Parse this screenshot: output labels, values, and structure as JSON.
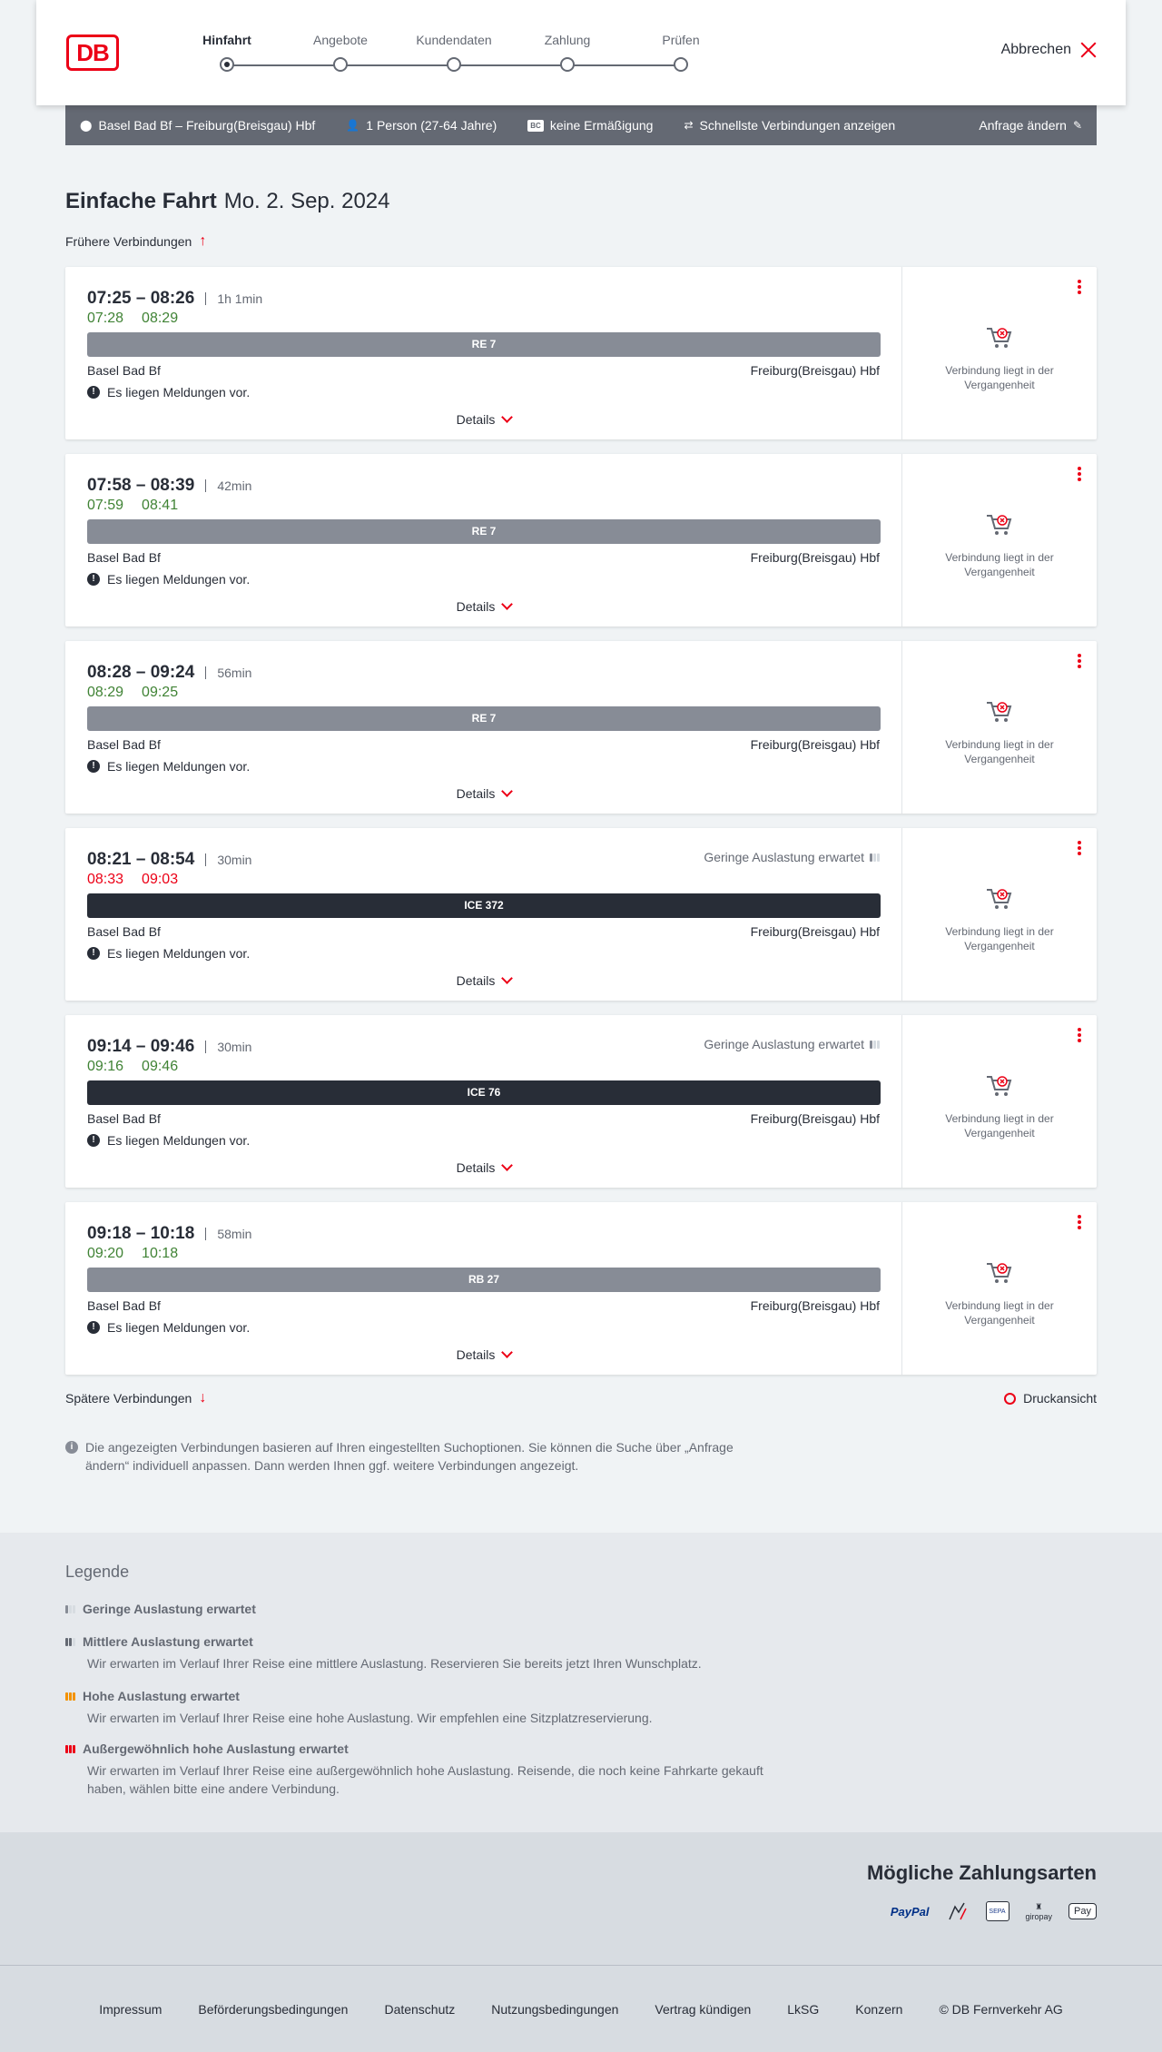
{
  "header": {
    "logo": "DB",
    "steps": [
      {
        "label": "Hinfahrt",
        "active": true
      },
      {
        "label": "Angebote",
        "active": false
      },
      {
        "label": "Kundendaten",
        "active": false
      },
      {
        "label": "Zahlung",
        "active": false
      },
      {
        "label": "Prüfen",
        "active": false
      }
    ],
    "cancel_label": "Abbrechen"
  },
  "summary": {
    "route": "Basel Bad Bf – Freiburg(Breisgau) Hbf",
    "passengers": "1 Person (27-64 Jahre)",
    "discount_badge": "BC",
    "discount": "keine Ermäßigung",
    "fastest": "Schnellste Verbindungen anzeigen",
    "change": "Anfrage ändern"
  },
  "title": {
    "main": "Einfache Fahrt",
    "date": "Mo. 2. Sep. 2024"
  },
  "earlier_label": "Frühere Verbindungen",
  "later_label": "Spätere Verbindungen",
  "print_label": "Druckansicht",
  "connections": [
    {
      "times": "07:25 – 08:26",
      "duration": "1h 1min",
      "rt_dep": "07:28",
      "rt_arr": "08:29",
      "rt_status": "ok",
      "train": "RE 7",
      "train_type": "reg",
      "from": "Basel Bad Bf",
      "to": "Freiburg(Breisgau) Hbf",
      "message": "Es liegen Meldungen vor.",
      "details": "Details",
      "load": "",
      "past": "Verbindung liegt in der Vergangenheit"
    },
    {
      "times": "07:58 – 08:39",
      "duration": "42min",
      "rt_dep": "07:59",
      "rt_arr": "08:41",
      "rt_status": "ok",
      "train": "RE 7",
      "train_type": "reg",
      "from": "Basel Bad Bf",
      "to": "Freiburg(Breisgau) Hbf",
      "message": "Es liegen Meldungen vor.",
      "details": "Details",
      "load": "",
      "past": "Verbindung liegt in der Vergangenheit"
    },
    {
      "times": "08:28 – 09:24",
      "duration": "56min",
      "rt_dep": "08:29",
      "rt_arr": "09:25",
      "rt_status": "ok",
      "train": "RE 7",
      "train_type": "reg",
      "from": "Basel Bad Bf",
      "to": "Freiburg(Breisgau) Hbf",
      "message": "Es liegen Meldungen vor.",
      "details": "Details",
      "load": "",
      "past": "Verbindung liegt in der Vergangenheit"
    },
    {
      "times": "08:21 – 08:54",
      "duration": "30min",
      "rt_dep": "08:33",
      "rt_arr": "09:03",
      "rt_status": "late",
      "train": "ICE 372",
      "train_type": "ice",
      "from": "Basel Bad Bf",
      "to": "Freiburg(Breisgau) Hbf",
      "message": "Es liegen Meldungen vor.",
      "details": "Details",
      "load": "Geringe Auslastung erwartet",
      "past": "Verbindung liegt in der Vergangenheit"
    },
    {
      "times": "09:14 – 09:46",
      "duration": "30min",
      "rt_dep": "09:16",
      "rt_arr": "09:46",
      "rt_status": "ok",
      "train": "ICE 76",
      "train_type": "ice",
      "from": "Basel Bad Bf",
      "to": "Freiburg(Breisgau) Hbf",
      "message": "Es liegen Meldungen vor.",
      "details": "Details",
      "load": "Geringe Auslastung erwartet",
      "past": "Verbindung liegt in der Vergangenheit"
    },
    {
      "times": "09:18 – 10:18",
      "duration": "58min",
      "rt_dep": "09:20",
      "rt_arr": "10:18",
      "rt_status": "ok",
      "train": "RB 27",
      "train_type": "reg",
      "from": "Basel Bad Bf",
      "to": "Freiburg(Breisgau) Hbf",
      "message": "Es liegen Meldungen vor.",
      "details": "Details",
      "load": "",
      "past": "Verbindung liegt in der Vergangenheit"
    }
  ],
  "info_text": "Die angezeigten Verbindungen basieren auf Ihren eingestellten Suchoptionen. Sie können die Suche über „Anfrage ändern“ individuell anpassen. Dann werden Ihnen ggf. weitere Verbindungen angezeigt.",
  "legend": {
    "title": "Legende",
    "items": [
      {
        "title": "Geringe Auslastung erwartet",
        "text": "",
        "color": "#878c96",
        "filled": 1
      },
      {
        "title": "Mittlere Auslastung erwartet",
        "text": "Wir erwarten im Verlauf Ihrer Reise eine mittlere Auslastung. Reservieren Sie bereits jetzt Ihren Wunschplatz.",
        "color": "#646973",
        "filled": 2
      },
      {
        "title": "Hohe Auslastung erwartet",
        "text": "Wir erwarten im Verlauf Ihrer Reise eine hohe Auslastung. Wir empfehlen eine Sitzplatzreservierung.",
        "color": "#f39200",
        "filled": 3
      },
      {
        "title": "Außergewöhnlich hohe Auslastung erwartet",
        "text": "Wir erwarten im Verlauf Ihrer Reise eine außergewöhnlich hohe Auslastung. Reisende, die noch keine Fahrkarte gekauft haben, wählen bitte eine andere Verbindung.",
        "color": "#ec0016",
        "filled": 3
      }
    ]
  },
  "payment": {
    "title": "Mögliche Zahlungsarten",
    "paypal": "PayPal",
    "sepa": "SEPA",
    "giropay": "giropay",
    "applepay": "Pay"
  },
  "footer": [
    "Impressum",
    "Beförderungsbedingungen",
    "Datenschutz",
    "Nutzungsbedingungen",
    "Vertrag kündigen",
    "LkSG",
    "Konzern",
    "© DB Fernverkehr AG"
  ]
}
